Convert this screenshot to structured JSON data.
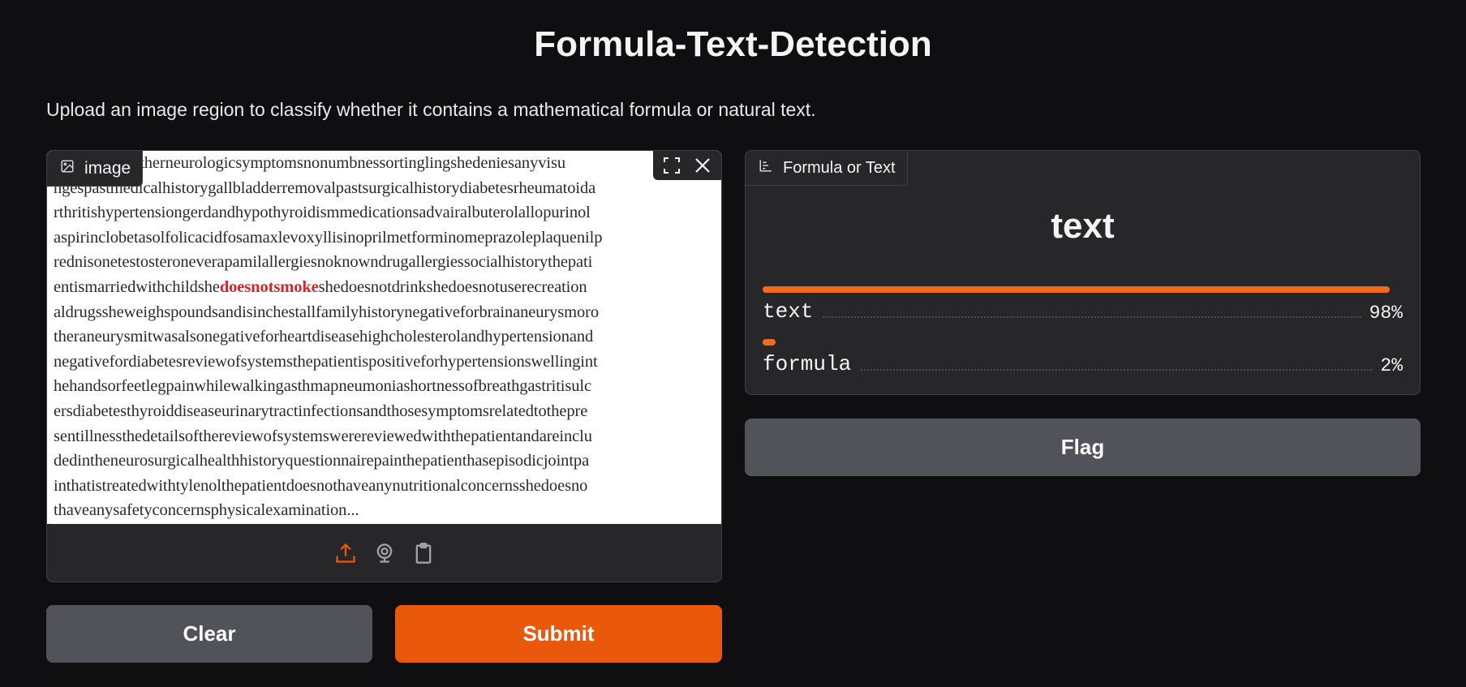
{
  "title": "Formula-Text-Detection",
  "description": "Upload an image region to classify whether it contains a mathematical formula or natural text.",
  "input": {
    "label": "image",
    "icon": "image-icon",
    "image_text_lines": [
      "otherneurologicsymptomsnonumbnessortinglingshedeniesanyvisu",
      "ngespastmedicalhistorygallbladderremovalpastsurgicalhistorydiabetesrheumatoida",
      "rthritishypertensiongerdandhypothyroidismmedicationsadvairalbuterolallopurinol",
      "aspirinclobetasolfolicacidfosamaxlevoxyllisinoprilmetforminomeprazoleplaquenilp",
      "rednisonetestosteroneverapamilallergiesnoknowndrugallergiessocialhistorythepati",
      "shedoesnotdrinkshedoesnotuserecreation",
      "aldrugssheweighspoundsandisinchestallfamilyhistorynegativeforbrainaneurysmoro",
      "theraneurysmitwasalsonegativeforheartdiseasehighcholesterolandhypertensionand",
      "negativefordiabetesreviewofsystemsthepatientispositiveforhypertensionswellingint",
      "hehandsorfeetlegpainwhilewalkingasthmapneumoniashortnessofbreathgastritisulc",
      "ersdiabetesthyroiddiseaseurinarytractinfectionsandthosesymptomsrelatedtothepre",
      "sentillnessthedetailsofthereviewofsystemswerereviewedwiththepatientandareinclu",
      "dedintheneurosurgicalhealthhistoryquestionnairepainthepatienthasepisodicjointpa",
      "inthatistreatedwithtylenolthepatientdoesnothaveanynutritionalconcernsshedoesno",
      "thaveanysafetyconcernsphysicalexamination..."
    ],
    "line6_prefix": "entismarriedwithchildshe",
    "line6_highlight": "doesnotsmoke",
    "sources": [
      "upload-icon",
      "webcam-icon",
      "clipboard-icon"
    ]
  },
  "buttons": {
    "clear": "Clear",
    "submit": "Submit",
    "flag": "Flag"
  },
  "output": {
    "label": "Formula or Text",
    "icon": "bar-chart-icon",
    "prediction": "text",
    "confidences": [
      {
        "label": "text",
        "value": 0.98,
        "display": "98%"
      },
      {
        "label": "formula",
        "value": 0.02,
        "display": "2%"
      }
    ]
  },
  "colors": {
    "background": "#0f0f11",
    "panel": "#27272a",
    "accent": "#ea580c",
    "secondary_button": "#52525b",
    "highlight_text": "#d6262b"
  }
}
